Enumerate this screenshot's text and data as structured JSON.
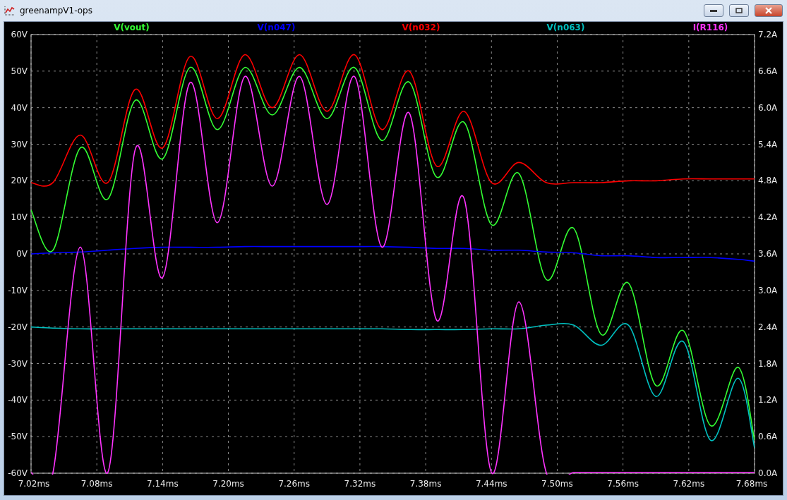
{
  "window": {
    "title": "greenampV1-ops"
  },
  "plot": {
    "chart_data": {
      "type": "line",
      "grid": true,
      "x": [
        7.02,
        7.04,
        7.065,
        7.09,
        7.115,
        7.14,
        7.165,
        7.19,
        7.215,
        7.24,
        7.265,
        7.29,
        7.315,
        7.34,
        7.365,
        7.39,
        7.415,
        7.44,
        7.465,
        7.49,
        7.515,
        7.54,
        7.565,
        7.59,
        7.615,
        7.64,
        7.665,
        7.68
      ],
      "xlim": [
        7.02,
        7.68
      ],
      "ylim": [
        -60,
        60
      ],
      "y2lim": [
        0,
        7.2
      ],
      "xticks": [
        {
          "value": 7.02,
          "label": "7.02ms"
        },
        {
          "value": 7.08,
          "label": "7.08ms"
        },
        {
          "value": 7.14,
          "label": "7.14ms"
        },
        {
          "value": 7.2,
          "label": "7.20ms"
        },
        {
          "value": 7.26,
          "label": "7.26ms"
        },
        {
          "value": 7.32,
          "label": "7.32ms"
        },
        {
          "value": 7.38,
          "label": "7.38ms"
        },
        {
          "value": 7.44,
          "label": "7.44ms"
        },
        {
          "value": 7.5,
          "label": "7.50ms"
        },
        {
          "value": 7.56,
          "label": "7.56ms"
        },
        {
          "value": 7.62,
          "label": "7.62ms"
        },
        {
          "value": 7.68,
          "label": "7.68ms"
        }
      ],
      "yticks": [
        {
          "value": 60,
          "label": "60V"
        },
        {
          "value": 50,
          "label": "50V"
        },
        {
          "value": 40,
          "label": "40V"
        },
        {
          "value": 30,
          "label": "30V"
        },
        {
          "value": 20,
          "label": "20V"
        },
        {
          "value": 10,
          "label": "10V"
        },
        {
          "value": 0,
          "label": "0V"
        },
        {
          "value": -10,
          "label": "-10V"
        },
        {
          "value": -20,
          "label": "-20V"
        },
        {
          "value": -30,
          "label": "-30V"
        },
        {
          "value": -40,
          "label": "-40V"
        },
        {
          "value": -50,
          "label": "-50V"
        },
        {
          "value": -60,
          "label": "-60V"
        }
      ],
      "y2ticks": [
        {
          "value": 7.2,
          "label": "7.2A"
        },
        {
          "value": 6.6,
          "label": "6.6A"
        },
        {
          "value": 6.0,
          "label": "6.0A"
        },
        {
          "value": 5.4,
          "label": "5.4A"
        },
        {
          "value": 4.8,
          "label": "4.8A"
        },
        {
          "value": 4.2,
          "label": "4.2A"
        },
        {
          "value": 3.6,
          "label": "3.6A"
        },
        {
          "value": 3.0,
          "label": "3.0A"
        },
        {
          "value": 2.4,
          "label": "2.4A"
        },
        {
          "value": 1.8,
          "label": "1.8A"
        },
        {
          "value": 1.2,
          "label": "1.2A"
        },
        {
          "value": 0.6,
          "label": "0.6A"
        },
        {
          "value": 0.0,
          "label": "0.0A"
        }
      ],
      "series": [
        {
          "name": "V(vout)",
          "color": "#33ff33",
          "values": [
            12,
            1,
            29,
            15,
            42,
            26,
            51,
            34,
            51,
            38,
            51,
            37,
            51,
            31,
            47,
            21,
            36,
            8,
            22,
            -7,
            7,
            -22,
            -8,
            -36,
            -21,
            -47,
            -31,
            -51
          ]
        },
        {
          "name": "V(n047)",
          "color": "#0000ff",
          "values": [
            0,
            0.3,
            0.5,
            1,
            1.5,
            1.8,
            1.8,
            1.8,
            2,
            2,
            2,
            2,
            2,
            2,
            1.8,
            1.5,
            1.5,
            1,
            1,
            0.5,
            0.3,
            -0.5,
            -0.5,
            -1,
            -1,
            -1,
            -1.5,
            -2
          ]
        },
        {
          "name": "V(n032)",
          "color": "#ff0000",
          "values": [
            19.5,
            19.5,
            32.5,
            19.5,
            45,
            29,
            54,
            37,
            54.5,
            40,
            54.5,
            39,
            54.5,
            34,
            50,
            24,
            39,
            19.5,
            25,
            19.5,
            19.5,
            19.5,
            20,
            20,
            20.5,
            20.5,
            20.5,
            20.5
          ]
        },
        {
          "name": "V(n063)",
          "color": "#00c0c0",
          "values": [
            -20,
            -20.3,
            -20.5,
            -20.5,
            -20.5,
            -20.5,
            -20.5,
            -20.5,
            -20.5,
            -20.5,
            -20.5,
            -20.5,
            -20.5,
            -20.5,
            -20.7,
            -20.7,
            -20.7,
            -20.5,
            -20.5,
            -19.5,
            -19.5,
            -25,
            -19.5,
            -39,
            -24,
            -51,
            -34,
            -53
          ]
        },
        {
          "name": "I(R116)",
          "color": "#ff33ff",
          "axis": "y2",
          "values": [
            0,
            0,
            3.7,
            0,
            5.3,
            3.2,
            6.4,
            4.1,
            6.5,
            4.7,
            6.5,
            4.4,
            6.5,
            3.7,
            5.9,
            2.5,
            4.5,
            0,
            2.8,
            0,
            0,
            0,
            0,
            0,
            0,
            0,
            0,
            0
          ]
        }
      ]
    }
  }
}
